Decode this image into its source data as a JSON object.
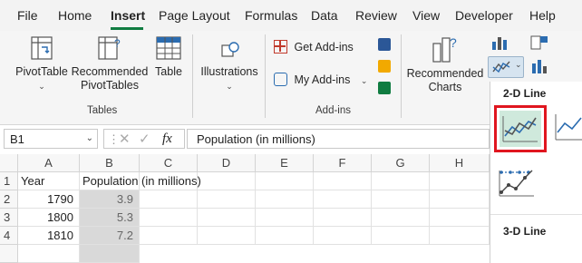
{
  "menu": {
    "tabs": [
      "File",
      "Home",
      "Insert",
      "Page Layout",
      "Formulas",
      "Data",
      "Review",
      "View",
      "Developer",
      "Help"
    ],
    "active": "Insert"
  },
  "ribbon": {
    "tables_group": {
      "pivottable": "PivotTable",
      "recommended_pivot_line1": "Recommended",
      "recommended_pivot_line2": "PivotTables",
      "table": "Table",
      "label": "Tables"
    },
    "illustrations": "Illustrations",
    "addins_group": {
      "get_addins": "Get Add-ins",
      "my_addins": "My Add-ins",
      "label": "Add-ins"
    },
    "recommended_charts_line1": "Recommended",
    "recommended_charts_line2": "Charts"
  },
  "formula_bar": {
    "name_box": "B1",
    "fx": "fx",
    "formula": "Population (in millions)"
  },
  "grid": {
    "columns": [
      "A",
      "B",
      "C",
      "D",
      "E",
      "F",
      "G",
      "H"
    ],
    "rows": [
      {
        "num": "1",
        "a": "Year",
        "b": "Population (in millions)"
      },
      {
        "num": "2",
        "a": "1790",
        "b": "3.9"
      },
      {
        "num": "3",
        "a": "1800",
        "b": "5.3"
      },
      {
        "num": "4",
        "a": "1810",
        "b": "7.2"
      }
    ]
  },
  "chart_dropdown": {
    "section_2d": "2-D Line",
    "section_3d": "3-D Line"
  },
  "colors": {
    "accent": "#107c41",
    "highlight_border": "#e0161f",
    "highlight_fill": "#cfe9dc"
  }
}
